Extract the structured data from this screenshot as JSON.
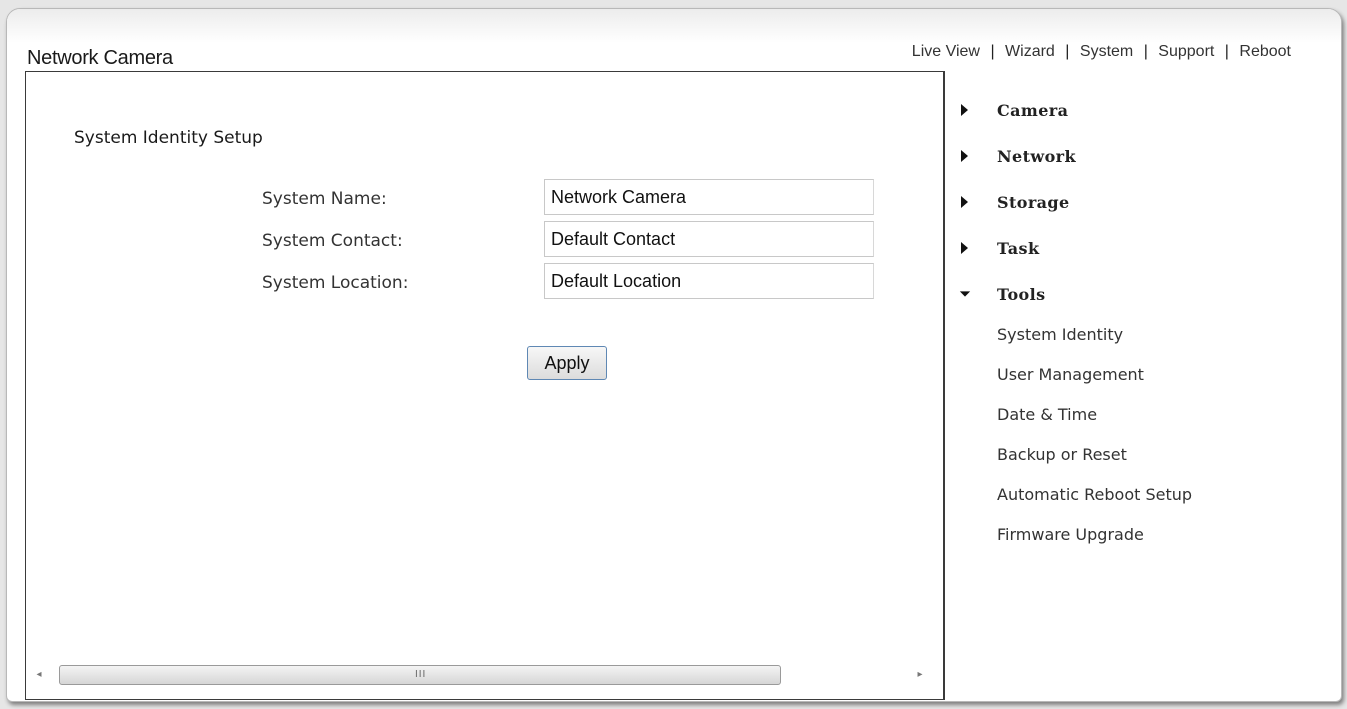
{
  "app": {
    "title": "Network Camera"
  },
  "topnav": [
    {
      "label": "Live View"
    },
    {
      "label": "Wizard"
    },
    {
      "label": "System"
    },
    {
      "label": "Support"
    },
    {
      "label": "Reboot"
    }
  ],
  "main": {
    "section_title": "System Identity Setup",
    "fields": [
      {
        "label": "System Name:",
        "value": "Network Camera"
      },
      {
        "label": "System Contact:",
        "value": "Default Contact"
      },
      {
        "label": "System Location:",
        "value": "Default Location"
      }
    ],
    "apply_label": "Apply",
    "scrollbar": {
      "grip": "III"
    }
  },
  "sidebar": {
    "items": [
      {
        "label": "Camera",
        "expanded": false,
        "icon": "triangle-right-icon"
      },
      {
        "label": "Network",
        "expanded": false,
        "icon": "triangle-right-icon"
      },
      {
        "label": "Storage",
        "expanded": false,
        "icon": "triangle-right-icon"
      },
      {
        "label": "Task",
        "expanded": false,
        "icon": "triangle-right-icon"
      },
      {
        "label": "Tools",
        "expanded": true,
        "icon": "triangle-down-icon"
      }
    ],
    "tools_submenu": [
      {
        "label": "System Identity"
      },
      {
        "label": "User Management"
      },
      {
        "label": "Date & Time"
      },
      {
        "label": "Backup or Reset"
      },
      {
        "label": "Automatic Reboot Setup"
      },
      {
        "label": "Firmware Upgrade"
      }
    ]
  }
}
